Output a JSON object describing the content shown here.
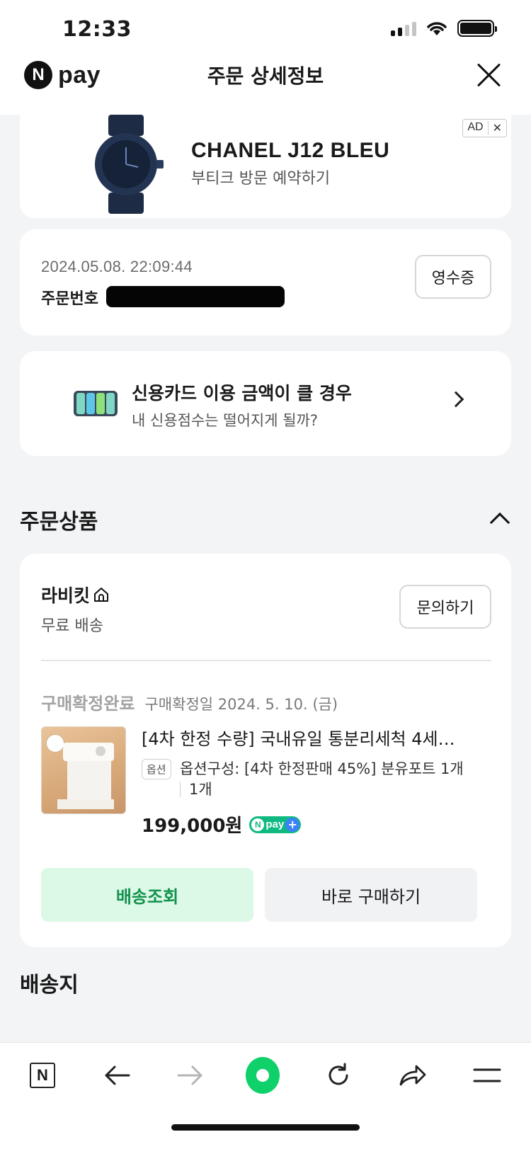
{
  "status_bar": {
    "time": "12:33"
  },
  "header": {
    "brand": "pay",
    "brand_n": "N",
    "title": "주문 상세정보"
  },
  "ad": {
    "title": "CHANEL J12 BLEU",
    "subtitle": "부티크 방문 예약하기",
    "badge": "AD",
    "close": "✕"
  },
  "order": {
    "datetime": "2024.05.08. 22:09:44",
    "order_no_label": "주문번호",
    "receipt_label": "영수증"
  },
  "credit_banner": {
    "title": "신용카드 이용 금액이 클 경우",
    "subtitle": "내 신용점수는 떨어지게 될까?"
  },
  "ordered_products": {
    "section_title": "주문상품",
    "seller": "라비킷",
    "shipping": "무료 배송",
    "inquiry_label": "문의하기",
    "status": "구매확정완료",
    "confirm_date": "구매확정일 2024. 5. 10. (금)",
    "product_name": "[4차 한정 수량] 국내유일 통분리세척 4세…",
    "option_tag": "옵션",
    "option_text": "옵션구성: [4차 한정판매 45%] 분유포트 1개",
    "option_qty": "1개",
    "price": "199,000원",
    "npay_plus": {
      "n": "N",
      "pay": "pay",
      "plus": "+"
    },
    "track_label": "배송조회",
    "buy_again_label": "바로 구매하기"
  },
  "delivery": {
    "section_title": "배송지"
  },
  "bottom_nav": {
    "n_label": "N"
  },
  "colors": {
    "accent_green": "#10d06a",
    "track_text": "#12924e",
    "track_bg": "#dcf8e6"
  }
}
